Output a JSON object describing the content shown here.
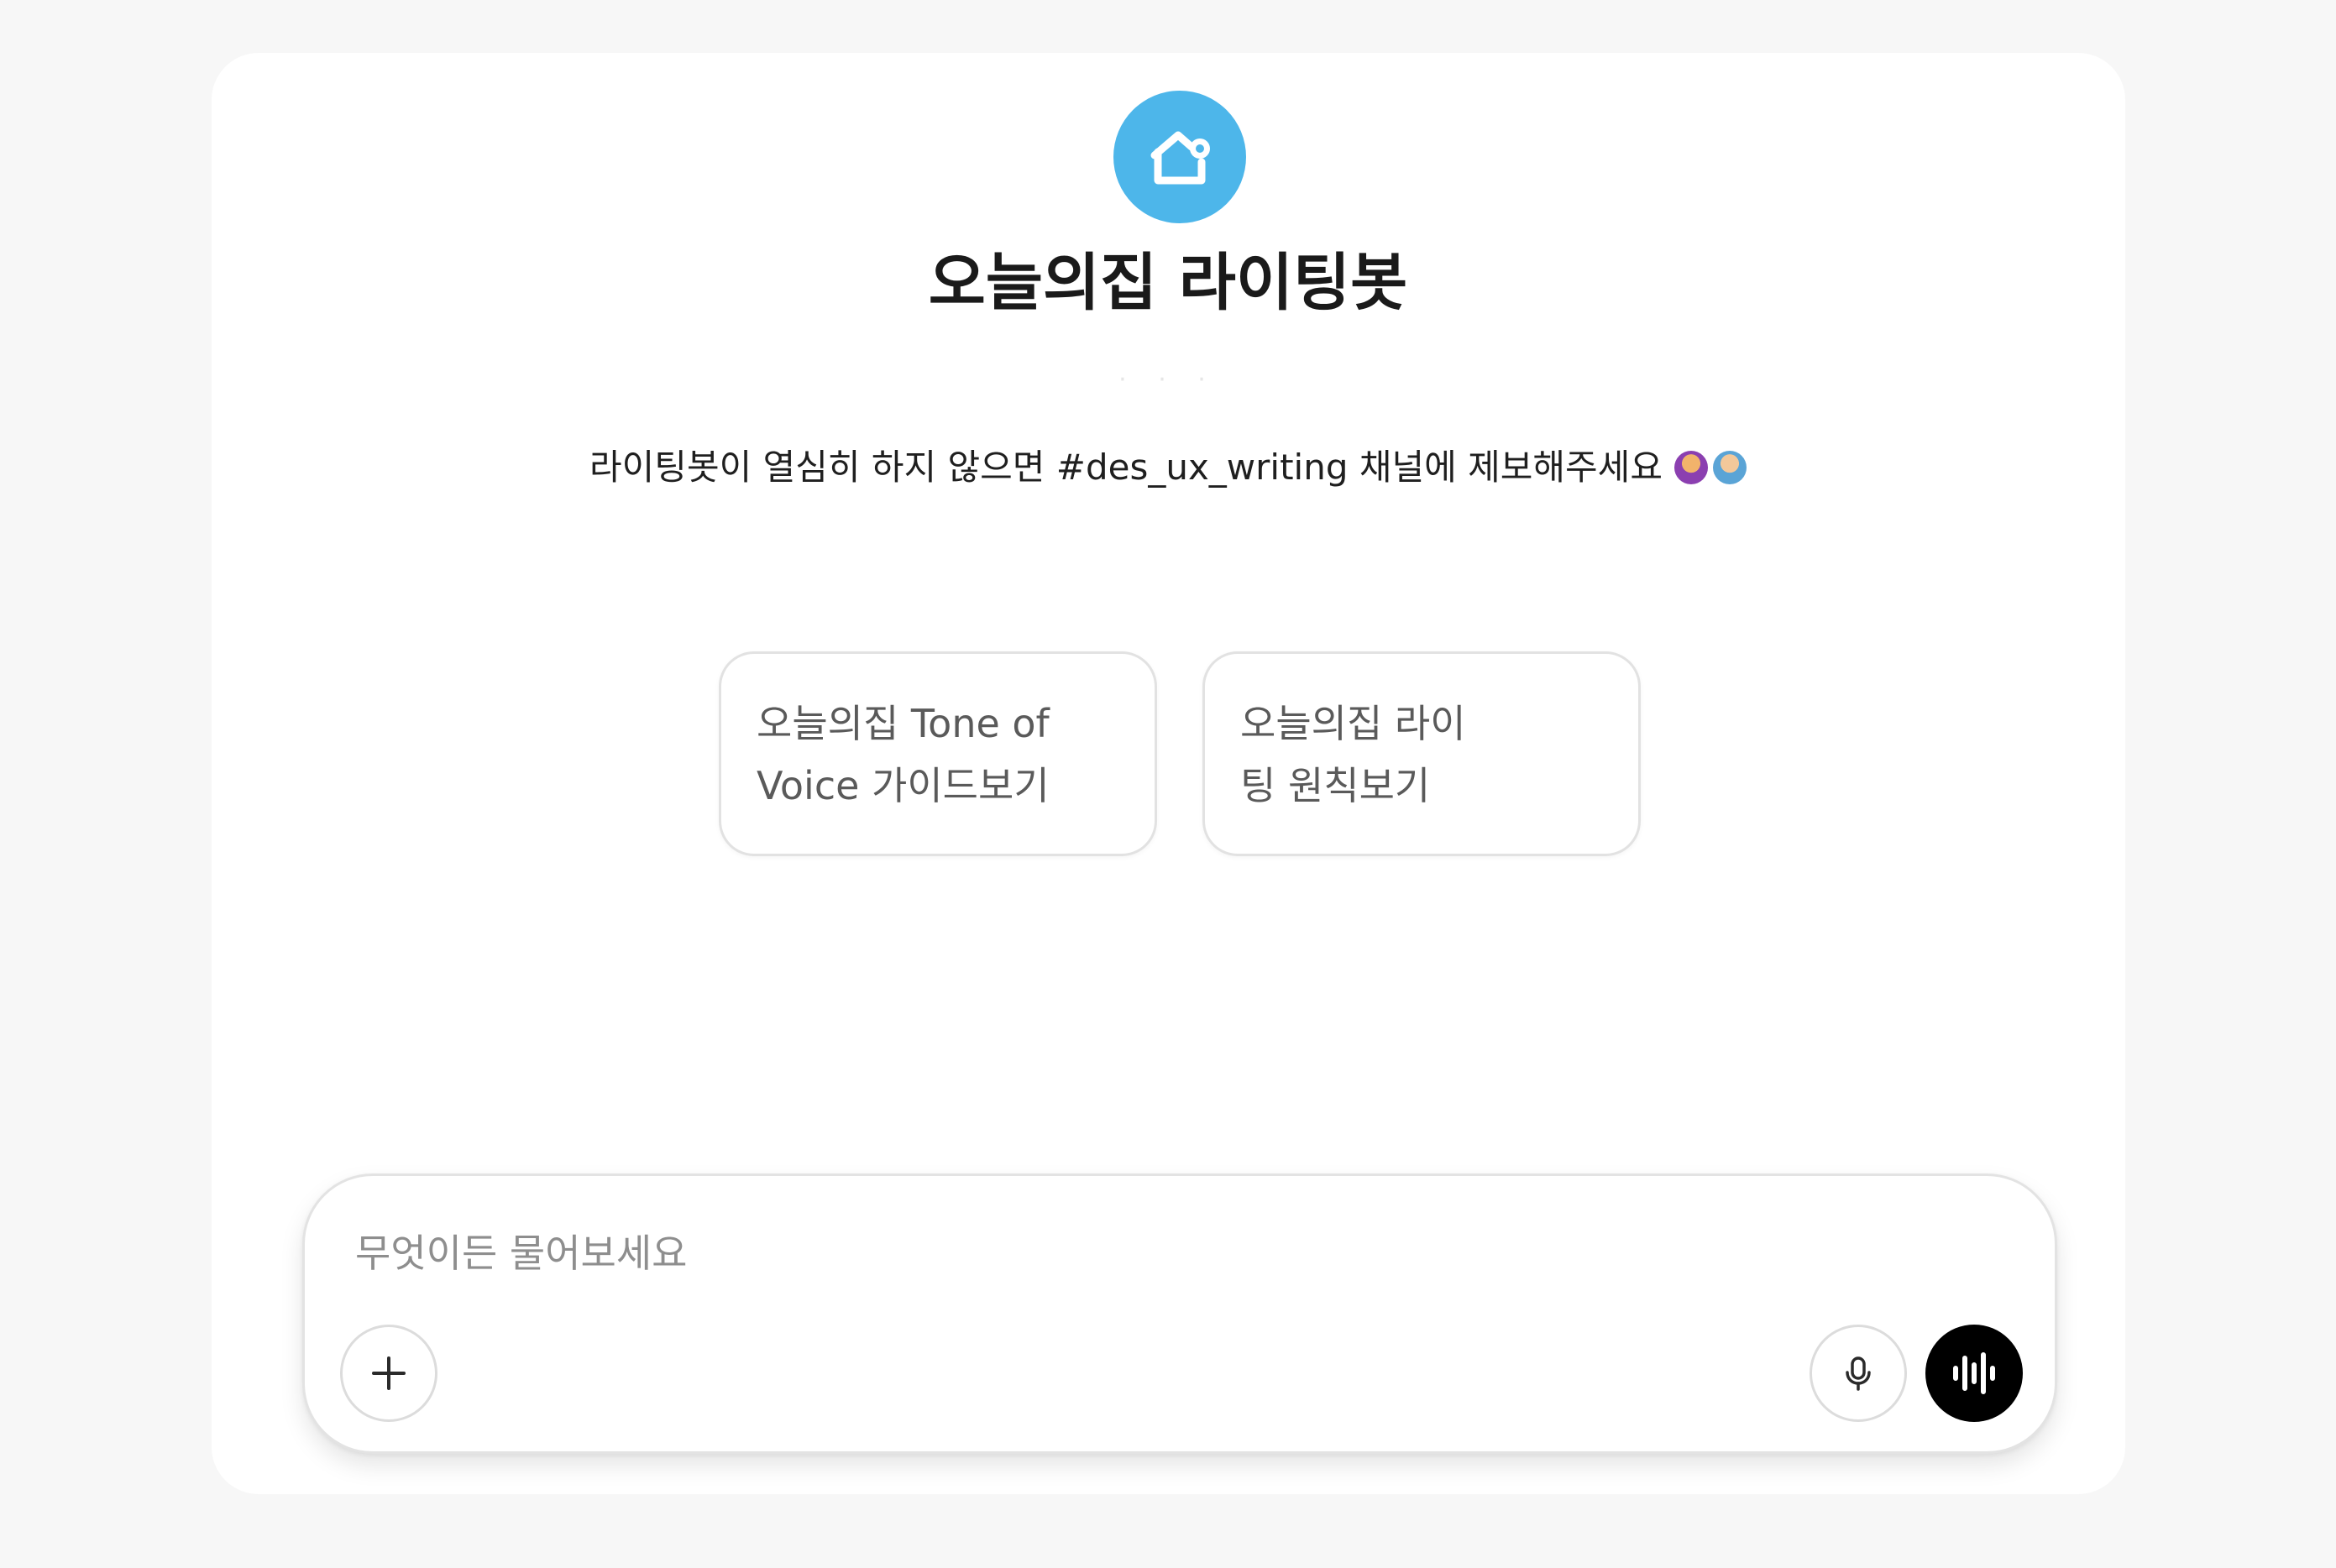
{
  "header": {
    "title": "오늘의집 라이팅봇",
    "dots": "· · ·",
    "description": "라이팅봇이 열심히 하지 않으면 #des_ux_writing 채널에 제보해주세요"
  },
  "logo": {
    "icon": "house-icon",
    "color": "#4db6ea"
  },
  "suggestions": [
    {
      "line1": "오늘의집 Tone of",
      "line2": "Voice 가이드보기"
    },
    {
      "line1": "오늘의집 라이",
      "line2": "팅 원칙보기"
    }
  ],
  "composer": {
    "placeholder": "무엇이든 물어보세요",
    "value": "",
    "add_icon": "plus-icon",
    "mic_icon": "microphone-icon",
    "voice_icon": "voice-wave-icon"
  },
  "colors": {
    "accent": "#4db6ea",
    "voice_button": "#000000",
    "background": "#f7f7f7",
    "card": "#ffffff"
  }
}
